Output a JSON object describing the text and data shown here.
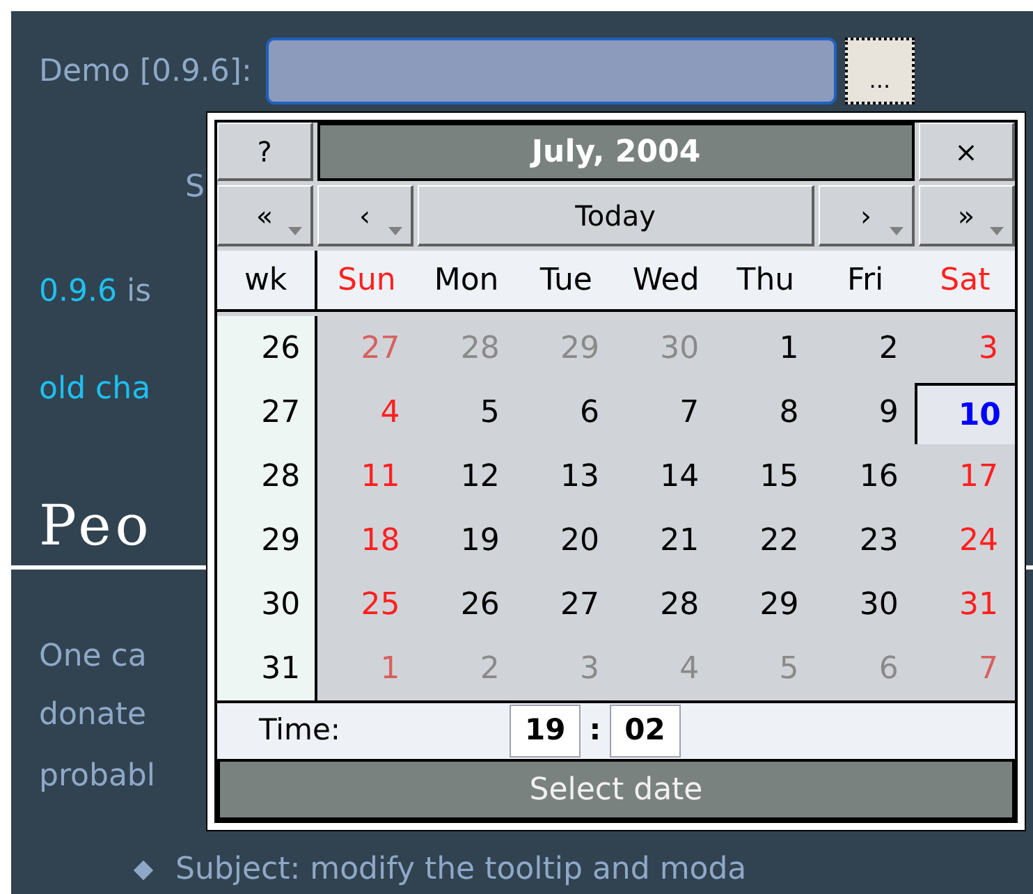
{
  "form": {
    "label": "Demo [0.9.6]:",
    "trigger_button": "..."
  },
  "page_fragments": [
    {
      "kind": "text",
      "text": "S"
    },
    {
      "kind": "version",
      "version": "0.9.6",
      "text": " is"
    },
    {
      "kind": "link",
      "text": "old cha"
    },
    {
      "kind": "heading",
      "text": "Peo"
    },
    {
      "kind": "text",
      "text": "One ca"
    },
    {
      "kind": "text",
      "text": "donate"
    },
    {
      "kind": "text",
      "text": "probabl"
    },
    {
      "kind": "bullet",
      "text": "Subject: modify the tooltip and moda"
    }
  ],
  "calendar": {
    "help_button": "?",
    "title": "July, 2004",
    "close_button": "×",
    "nav": [
      {
        "label": "«",
        "menu": true
      },
      {
        "label": "‹",
        "menu": true
      },
      {
        "label": "Today",
        "menu": false
      },
      {
        "label": "›",
        "menu": true
      },
      {
        "label": "»",
        "menu": true
      }
    ],
    "week_header": "wk",
    "weekdays": [
      {
        "label": "Sun",
        "weekend": true
      },
      {
        "label": "Mon",
        "weekend": false
      },
      {
        "label": "Tue",
        "weekend": false
      },
      {
        "label": "Wed",
        "weekend": false
      },
      {
        "label": "Thu",
        "weekend": false
      },
      {
        "label": "Fri",
        "weekend": false
      },
      {
        "label": "Sat",
        "weekend": true
      }
    ],
    "weeks": [
      {
        "wk": "26",
        "days": [
          {
            "day": "27",
            "other_month": true,
            "selected": false
          },
          {
            "day": "28",
            "other_month": true,
            "selected": false
          },
          {
            "day": "29",
            "other_month": true,
            "selected": false
          },
          {
            "day": "30",
            "other_month": true,
            "selected": false
          },
          {
            "day": "1",
            "other_month": false,
            "selected": false
          },
          {
            "day": "2",
            "other_month": false,
            "selected": false
          },
          {
            "day": "3",
            "other_month": false,
            "selected": false
          }
        ]
      },
      {
        "wk": "27",
        "days": [
          {
            "day": "4",
            "other_month": false,
            "selected": false
          },
          {
            "day": "5",
            "other_month": false,
            "selected": false
          },
          {
            "day": "6",
            "other_month": false,
            "selected": false
          },
          {
            "day": "7",
            "other_month": false,
            "selected": false
          },
          {
            "day": "8",
            "other_month": false,
            "selected": false
          },
          {
            "day": "9",
            "other_month": false,
            "selected": false
          },
          {
            "day": "10",
            "other_month": false,
            "selected": true
          }
        ]
      },
      {
        "wk": "28",
        "days": [
          {
            "day": "11",
            "other_month": false,
            "selected": false
          },
          {
            "day": "12",
            "other_month": false,
            "selected": false
          },
          {
            "day": "13",
            "other_month": false,
            "selected": false
          },
          {
            "day": "14",
            "other_month": false,
            "selected": false
          },
          {
            "day": "15",
            "other_month": false,
            "selected": false
          },
          {
            "day": "16",
            "other_month": false,
            "selected": false
          },
          {
            "day": "17",
            "other_month": false,
            "selected": false
          }
        ]
      },
      {
        "wk": "29",
        "days": [
          {
            "day": "18",
            "other_month": false,
            "selected": false
          },
          {
            "day": "19",
            "other_month": false,
            "selected": false
          },
          {
            "day": "20",
            "other_month": false,
            "selected": false
          },
          {
            "day": "21",
            "other_month": false,
            "selected": false
          },
          {
            "day": "22",
            "other_month": false,
            "selected": false
          },
          {
            "day": "23",
            "other_month": false,
            "selected": false
          },
          {
            "day": "24",
            "other_month": false,
            "selected": false
          }
        ]
      },
      {
        "wk": "30",
        "days": [
          {
            "day": "25",
            "other_month": false,
            "selected": false
          },
          {
            "day": "26",
            "other_month": false,
            "selected": false
          },
          {
            "day": "27",
            "other_month": false,
            "selected": false
          },
          {
            "day": "28",
            "other_month": false,
            "selected": false
          },
          {
            "day": "29",
            "other_month": false,
            "selected": false
          },
          {
            "day": "30",
            "other_month": false,
            "selected": false
          },
          {
            "day": "31",
            "other_month": false,
            "selected": false
          }
        ]
      },
      {
        "wk": "31",
        "days": [
          {
            "day": "1",
            "other_month": true,
            "selected": false
          },
          {
            "day": "2",
            "other_month": true,
            "selected": false
          },
          {
            "day": "3",
            "other_month": true,
            "selected": false
          },
          {
            "day": "4",
            "other_month": true,
            "selected": false
          },
          {
            "day": "5",
            "other_month": true,
            "selected": false
          },
          {
            "day": "6",
            "other_month": true,
            "selected": false
          },
          {
            "day": "7",
            "other_month": true,
            "selected": false
          }
        ]
      }
    ],
    "time": {
      "label": "Time:",
      "hours": "19",
      "separator": ":",
      "minutes": "02"
    },
    "select_button": "Select date"
  }
}
